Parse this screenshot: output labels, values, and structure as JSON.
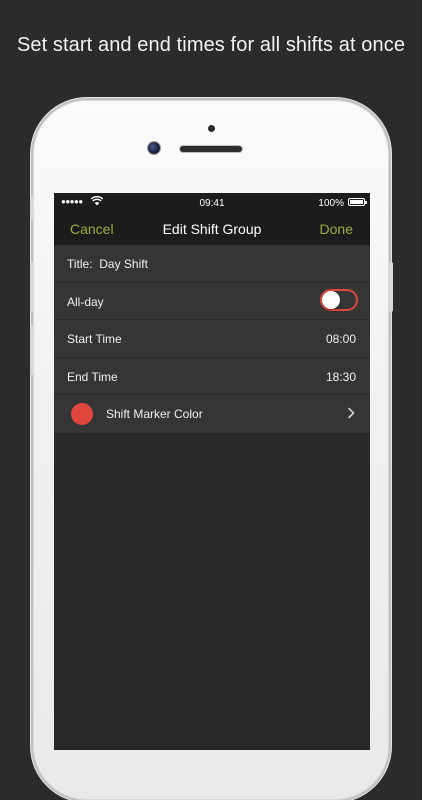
{
  "headline": "Set start and end times for all shifts at once",
  "colors": {
    "accent": "#9bae3d",
    "marker": "#e0473c",
    "background": "#282828"
  },
  "status_bar": {
    "signal": "●●●●●",
    "wifi_icon": "wifi-icon",
    "time": "09:41",
    "battery_percent": "100%",
    "battery_level": 1.0
  },
  "nav": {
    "cancel_label": "Cancel",
    "title": "Edit Shift Group",
    "done_label": "Done"
  },
  "rows": {
    "title": {
      "label": "Title:",
      "value": "Day Shift"
    },
    "all_day": {
      "label": "All-day",
      "toggle_on": false
    },
    "start_time": {
      "label": "Start Time",
      "value": "08:00"
    },
    "end_time": {
      "label": "End Time",
      "value": "18:30"
    },
    "marker_color": {
      "label": "Shift Marker Color",
      "icon": "chevron-right-icon"
    }
  }
}
